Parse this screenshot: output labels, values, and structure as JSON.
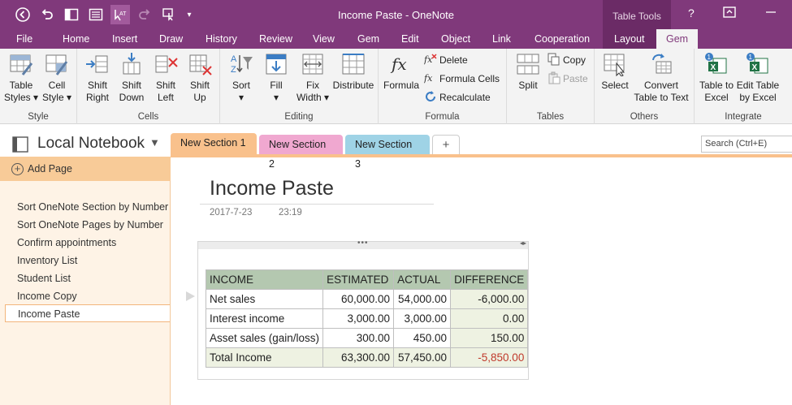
{
  "window": {
    "title": "Income Paste - OneNote",
    "contextual_group": "Table Tools",
    "help": "?"
  },
  "menu": {
    "tabs": [
      "File",
      "Home",
      "Insert",
      "Draw",
      "History",
      "Review",
      "View",
      "Gem",
      "Edit",
      "Object",
      "Link",
      "Cooperation",
      "Layout",
      "Gem"
    ]
  },
  "ribbon": {
    "style": {
      "label": "Style",
      "table_styles": "Table Styles",
      "cell_style": "Cell Style"
    },
    "cells": {
      "label": "Cells",
      "shift_right": "Shift Right",
      "shift_down": "Shift Down",
      "shift_left": "Shift Left",
      "shift_up": "Shift Up"
    },
    "editing": {
      "label": "Editing",
      "sort": "Sort",
      "fill": "Fill",
      "fix_width": "Fix Width",
      "distribute": "Distribute"
    },
    "formula": {
      "label": "Formula",
      "formula": "Formula",
      "delete": "Delete",
      "formula_cells": "Formula Cells",
      "recalculate": "Recalculate"
    },
    "tables": {
      "label": "Tables",
      "split": "Split",
      "copy": "Copy",
      "paste": "Paste"
    },
    "others": {
      "label": "Others",
      "select": "Select",
      "convert": "Convert Table to Text"
    },
    "integrate": {
      "label": "Integrate",
      "table_to_excel": "Table to Excel",
      "edit_table_by_excel": "Edit Table by Excel"
    }
  },
  "notebook": {
    "name": "Local Notebook",
    "sections": [
      {
        "name": "New Section 1",
        "color": "#f9c18c"
      },
      {
        "name": "New Section 2",
        "color": "#f0a8d0"
      },
      {
        "name": "New Section 3",
        "color": "#9fd3e6"
      }
    ],
    "add_section": "+",
    "search_placeholder": "Search (Ctrl+E)"
  },
  "pages": {
    "add_page": "Add Page",
    "items": [
      "Sort OneNote Section by Number",
      "Sort OneNote Pages by Number",
      "Confirm appointments",
      "Inventory List",
      "Student List",
      "Income Copy",
      "Income Paste"
    ],
    "selected_index": 6
  },
  "page": {
    "title": "Income Paste",
    "date": "2017-7-23",
    "time": "23:19"
  },
  "table": {
    "headers": [
      "INCOME",
      "ESTIMATED",
      "ACTUAL",
      "DIFFERENCE"
    ],
    "rows": [
      [
        "Net sales",
        "60,000.00",
        "54,000.00",
        "-6,000.00"
      ],
      [
        "Interest income",
        "3,000.00",
        "3,000.00",
        "0.00"
      ],
      [
        "Asset sales (gain/loss)",
        "300.00",
        "450.00",
        "150.00"
      ],
      [
        "Total Income",
        "63,300.00",
        "57,450.00",
        "-5,850.00"
      ]
    ]
  },
  "colors": {
    "accent": "#80397b",
    "table_header": "#b4c8b0",
    "negative": "#c0392b"
  }
}
